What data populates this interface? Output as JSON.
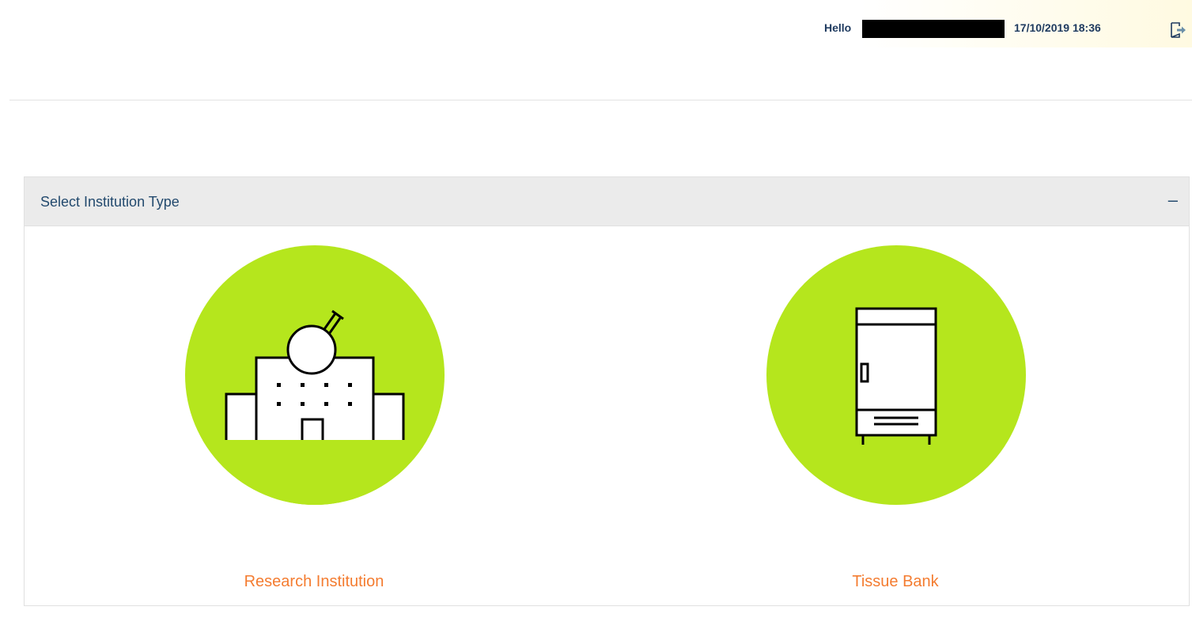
{
  "header": {
    "greeting": "Hello",
    "user_name": "",
    "datetime": "17/10/2019 18:36",
    "logout_icon": "logout-icon"
  },
  "panel": {
    "title": "Select Institution Type",
    "toggle_label": "–",
    "options": [
      {
        "label": "Research Institution",
        "icon": "research-building-icon"
      },
      {
        "label": "Tissue Bank",
        "icon": "freezer-icon"
      }
    ]
  },
  "colors": {
    "accent_green": "#b5e61d",
    "label_orange": "#f47c30",
    "title_blue": "#234a6e",
    "header_bg": "#ebebeb"
  }
}
